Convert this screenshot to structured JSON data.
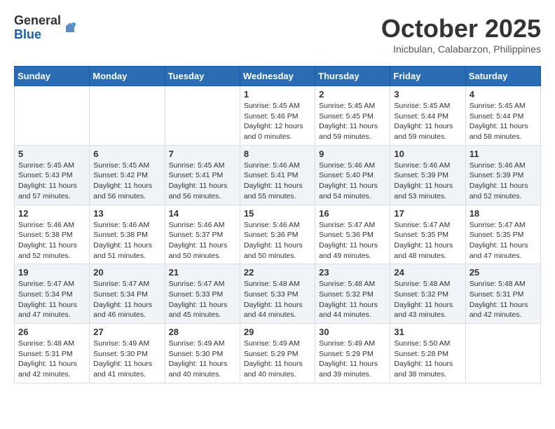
{
  "header": {
    "logo_general": "General",
    "logo_blue": "Blue",
    "month_title": "October 2025",
    "location": "Inicbulan, Calabarzon, Philippines"
  },
  "weekdays": [
    "Sunday",
    "Monday",
    "Tuesday",
    "Wednesday",
    "Thursday",
    "Friday",
    "Saturday"
  ],
  "weeks": [
    [
      {
        "day": "",
        "info": ""
      },
      {
        "day": "",
        "info": ""
      },
      {
        "day": "",
        "info": ""
      },
      {
        "day": "1",
        "info": "Sunrise: 5:45 AM\nSunset: 5:46 PM\nDaylight: 12 hours\nand 0 minutes."
      },
      {
        "day": "2",
        "info": "Sunrise: 5:45 AM\nSunset: 5:45 PM\nDaylight: 11 hours\nand 59 minutes."
      },
      {
        "day": "3",
        "info": "Sunrise: 5:45 AM\nSunset: 5:44 PM\nDaylight: 11 hours\nand 59 minutes."
      },
      {
        "day": "4",
        "info": "Sunrise: 5:45 AM\nSunset: 5:44 PM\nDaylight: 11 hours\nand 58 minutes."
      }
    ],
    [
      {
        "day": "5",
        "info": "Sunrise: 5:45 AM\nSunset: 5:43 PM\nDaylight: 11 hours\nand 57 minutes."
      },
      {
        "day": "6",
        "info": "Sunrise: 5:45 AM\nSunset: 5:42 PM\nDaylight: 11 hours\nand 56 minutes."
      },
      {
        "day": "7",
        "info": "Sunrise: 5:45 AM\nSunset: 5:41 PM\nDaylight: 11 hours\nand 56 minutes."
      },
      {
        "day": "8",
        "info": "Sunrise: 5:46 AM\nSunset: 5:41 PM\nDaylight: 11 hours\nand 55 minutes."
      },
      {
        "day": "9",
        "info": "Sunrise: 5:46 AM\nSunset: 5:40 PM\nDaylight: 11 hours\nand 54 minutes."
      },
      {
        "day": "10",
        "info": "Sunrise: 5:46 AM\nSunset: 5:39 PM\nDaylight: 11 hours\nand 53 minutes."
      },
      {
        "day": "11",
        "info": "Sunrise: 5:46 AM\nSunset: 5:39 PM\nDaylight: 11 hours\nand 52 minutes."
      }
    ],
    [
      {
        "day": "12",
        "info": "Sunrise: 5:46 AM\nSunset: 5:38 PM\nDaylight: 11 hours\nand 52 minutes."
      },
      {
        "day": "13",
        "info": "Sunrise: 5:46 AM\nSunset: 5:38 PM\nDaylight: 11 hours\nand 51 minutes."
      },
      {
        "day": "14",
        "info": "Sunrise: 5:46 AM\nSunset: 5:37 PM\nDaylight: 11 hours\nand 50 minutes."
      },
      {
        "day": "15",
        "info": "Sunrise: 5:46 AM\nSunset: 5:36 PM\nDaylight: 11 hours\nand 50 minutes."
      },
      {
        "day": "16",
        "info": "Sunrise: 5:47 AM\nSunset: 5:36 PM\nDaylight: 11 hours\nand 49 minutes."
      },
      {
        "day": "17",
        "info": "Sunrise: 5:47 AM\nSunset: 5:35 PM\nDaylight: 11 hours\nand 48 minutes."
      },
      {
        "day": "18",
        "info": "Sunrise: 5:47 AM\nSunset: 5:35 PM\nDaylight: 11 hours\nand 47 minutes."
      }
    ],
    [
      {
        "day": "19",
        "info": "Sunrise: 5:47 AM\nSunset: 5:34 PM\nDaylight: 11 hours\nand 47 minutes."
      },
      {
        "day": "20",
        "info": "Sunrise: 5:47 AM\nSunset: 5:34 PM\nDaylight: 11 hours\nand 46 minutes."
      },
      {
        "day": "21",
        "info": "Sunrise: 5:47 AM\nSunset: 5:33 PM\nDaylight: 11 hours\nand 45 minutes."
      },
      {
        "day": "22",
        "info": "Sunrise: 5:48 AM\nSunset: 5:33 PM\nDaylight: 11 hours\nand 44 minutes."
      },
      {
        "day": "23",
        "info": "Sunrise: 5:48 AM\nSunset: 5:32 PM\nDaylight: 11 hours\nand 44 minutes."
      },
      {
        "day": "24",
        "info": "Sunrise: 5:48 AM\nSunset: 5:32 PM\nDaylight: 11 hours\nand 43 minutes."
      },
      {
        "day": "25",
        "info": "Sunrise: 5:48 AM\nSunset: 5:31 PM\nDaylight: 11 hours\nand 42 minutes."
      }
    ],
    [
      {
        "day": "26",
        "info": "Sunrise: 5:48 AM\nSunset: 5:31 PM\nDaylight: 11 hours\nand 42 minutes."
      },
      {
        "day": "27",
        "info": "Sunrise: 5:49 AM\nSunset: 5:30 PM\nDaylight: 11 hours\nand 41 minutes."
      },
      {
        "day": "28",
        "info": "Sunrise: 5:49 AM\nSunset: 5:30 PM\nDaylight: 11 hours\nand 40 minutes."
      },
      {
        "day": "29",
        "info": "Sunrise: 5:49 AM\nSunset: 5:29 PM\nDaylight: 11 hours\nand 40 minutes."
      },
      {
        "day": "30",
        "info": "Sunrise: 5:49 AM\nSunset: 5:29 PM\nDaylight: 11 hours\nand 39 minutes."
      },
      {
        "day": "31",
        "info": "Sunrise: 5:50 AM\nSunset: 5:28 PM\nDaylight: 11 hours\nand 38 minutes."
      },
      {
        "day": "",
        "info": ""
      }
    ]
  ]
}
